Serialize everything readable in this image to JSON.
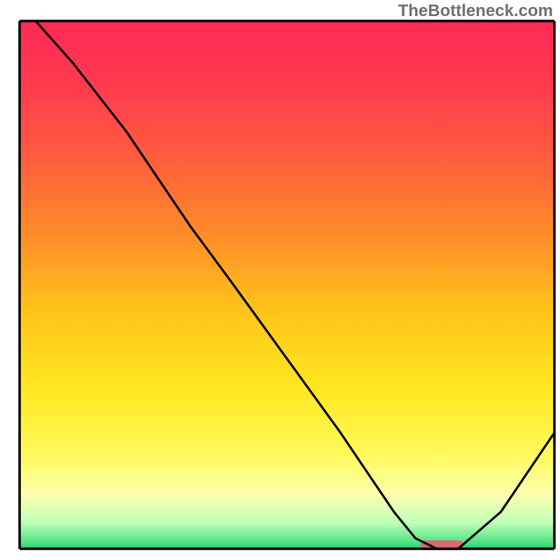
{
  "watermark": "TheBottleneck.com",
  "chart_data": {
    "type": "line",
    "title": "",
    "xlabel": "",
    "ylabel": "",
    "xlim": [
      0,
      100
    ],
    "ylim": [
      0,
      100
    ],
    "series": [
      {
        "name": "bottleneck-curve",
        "x": [
          3,
          10,
          20,
          26,
          32,
          40,
          50,
          60,
          66,
          70,
          74,
          78,
          82,
          90,
          100
        ],
        "y": [
          100,
          92,
          79,
          70,
          61,
          50,
          36,
          22,
          13,
          7,
          2,
          0,
          0,
          7,
          22
        ]
      }
    ],
    "marker": {
      "name": "optimal-marker",
      "x_center": 79,
      "width": 8,
      "color": "#d66a6f"
    },
    "background": {
      "gradient_stops": [
        {
          "offset": 0.0,
          "color": "#ff2a55"
        },
        {
          "offset": 0.12,
          "color": "#ff3a4f"
        },
        {
          "offset": 0.25,
          "color": "#ff5a3f"
        },
        {
          "offset": 0.4,
          "color": "#ff8a2a"
        },
        {
          "offset": 0.55,
          "color": "#ffc41a"
        },
        {
          "offset": 0.7,
          "color": "#ffe820"
        },
        {
          "offset": 0.82,
          "color": "#fff95a"
        },
        {
          "offset": 0.9,
          "color": "#faffb0"
        },
        {
          "offset": 0.95,
          "color": "#c0ffb8"
        },
        {
          "offset": 0.99,
          "color": "#4ae080"
        },
        {
          "offset": 1.0,
          "color": "#20d070"
        }
      ]
    },
    "axes": {
      "stroke": "#000000",
      "stroke_width": 3.5
    }
  }
}
